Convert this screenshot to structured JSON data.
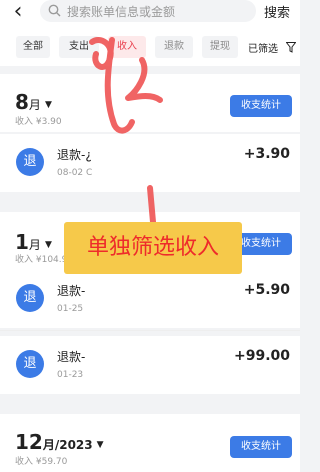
{
  "header": {
    "search_placeholder": "搜索账单信息或金额",
    "search_button": "搜索"
  },
  "filters": {
    "chips": [
      "全部",
      "支出",
      "收入",
      "退款",
      "提现"
    ],
    "active": "收入",
    "filtered_label": "已筛选"
  },
  "months": [
    {
      "month": "8",
      "month_suffix": "月",
      "summary": "收入 ¥3.90",
      "stat_button": "收支统计",
      "items": [
        {
          "icon_text": "退",
          "title": "退款-¿",
          "date": "08-02 C",
          "amount": "+3.90"
        }
      ]
    },
    {
      "month": "1",
      "month_suffix": "月",
      "summary": "收入 ¥104.9",
      "stat_button": "收支统计",
      "items": [
        {
          "icon_text": "退",
          "title": "退款-",
          "date": "01-25",
          "amount": "+5.90"
        },
        {
          "icon_text": "退",
          "title": "退款-",
          "date": "01-23",
          "amount": "+99.00"
        }
      ]
    },
    {
      "month": "12",
      "month_suffix": "月/2023",
      "summary": "收入 ¥59.70",
      "stat_button": "收支统计",
      "items": []
    }
  ],
  "annotation": {
    "note_text": "单独筛选收入",
    "colors": {
      "note_bg": "#f6c94a",
      "note_text": "#ee2b2b",
      "scribble": "#ee4a4a"
    }
  },
  "colors": {
    "accent": "#3c7be6",
    "active_chip_bg": "#fde9ea",
    "active_chip_text": "#e9414f"
  }
}
